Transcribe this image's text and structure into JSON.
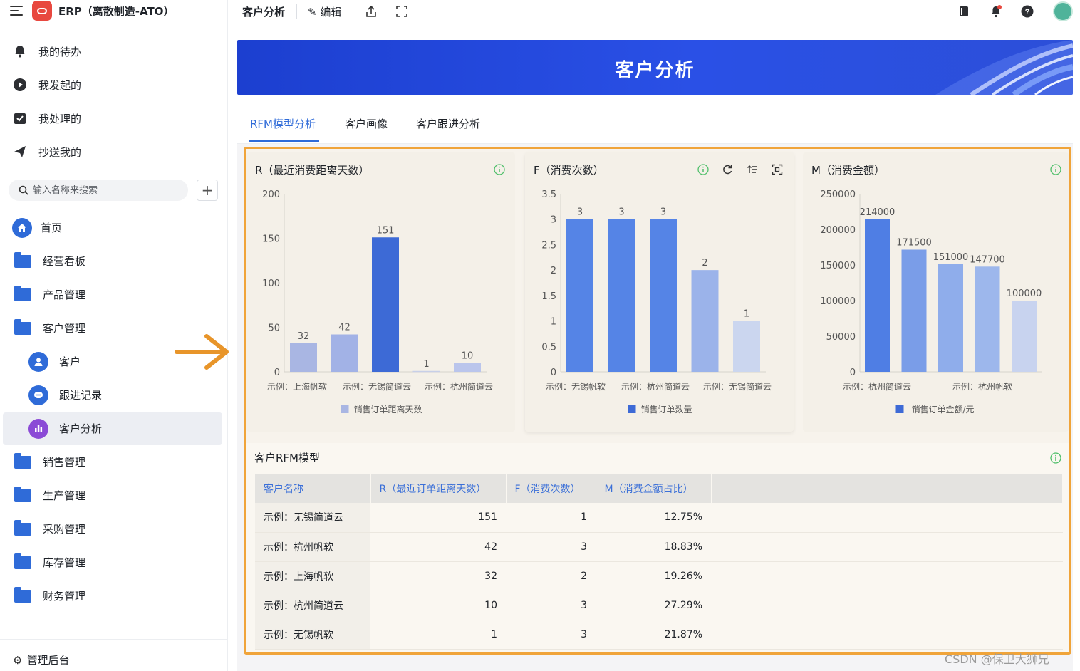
{
  "app": {
    "title": "ERP（离散制造-ATO）"
  },
  "quick_items": [
    {
      "label": "我的待办",
      "icon": "bell-icon"
    },
    {
      "label": "我发起的",
      "icon": "play-circle-icon"
    },
    {
      "label": "我处理的",
      "icon": "check-box-icon"
    },
    {
      "label": "抄送我的",
      "icon": "paper-plane-icon"
    }
  ],
  "search": {
    "placeholder": "输入名称来搜索"
  },
  "nav": [
    {
      "label": "首页",
      "icon": "home-icon"
    },
    {
      "label": "经营看板",
      "icon": "folder-icon"
    },
    {
      "label": "产品管理",
      "icon": "folder-icon"
    },
    {
      "label": "客户管理",
      "icon": "folder-icon"
    },
    {
      "label": "客户",
      "icon": "user-icon"
    },
    {
      "label": "跟进记录",
      "icon": "message-icon"
    },
    {
      "label": "客户分析",
      "icon": "bar-chart-icon"
    },
    {
      "label": "销售管理",
      "icon": "folder-icon"
    },
    {
      "label": "生产管理",
      "icon": "folder-icon"
    },
    {
      "label": "采购管理",
      "icon": "folder-icon"
    },
    {
      "label": "库存管理",
      "icon": "folder-icon"
    },
    {
      "label": "财务管理",
      "icon": "folder-icon"
    }
  ],
  "admin": {
    "label": "管理后台"
  },
  "topbar": {
    "page_name": "客户分析",
    "edit_label": "编辑"
  },
  "banner": {
    "title": "客户分析"
  },
  "tabs": [
    "RFM模型分析",
    "客户画像",
    "客户跟进分析"
  ],
  "colors": {
    "accent": "#2f6bd8",
    "highlight": "#f0a43a",
    "banner": "#2a50e6"
  },
  "chart_data": [
    {
      "type": "bar",
      "title": "R（最近消费距离天数）",
      "categories": [
        "示例：上海帆软",
        "示例：无锡简道云",
        "示例：杭州帆软",
        "示例：无锡帆软",
        "示例：杭州简道云"
      ],
      "x_tick_labels": [
        "示例：上海帆软",
        "示例：无锡简道云",
        "示例：杭州简道云"
      ],
      "values": [
        32,
        42,
        151,
        1,
        10
      ],
      "y_ticks": [
        "200",
        "150",
        "100",
        "50",
        "0"
      ],
      "ylim": [
        0,
        200
      ],
      "legend": "销售订单距离天数",
      "legend_position": "bottom"
    },
    {
      "type": "bar",
      "title": "F（消费次数）",
      "categories": [
        "示例：无锡帆软",
        "示例：杭州帆软",
        "示例：杭州简道云",
        "示例：上海帆软",
        "示例：无锡简道云"
      ],
      "x_tick_labels": [
        "示例：无锡帆软",
        "示例：杭州简道云",
        "示例：无锡简道云"
      ],
      "values": [
        3,
        3,
        3,
        2,
        1
      ],
      "y_ticks": [
        "3.5",
        "3",
        "2.5",
        "2",
        "1.5",
        "1",
        "0.5",
        "0"
      ],
      "ylim": [
        0,
        3.5
      ],
      "legend": "销售订单数量",
      "legend_position": "bottom"
    },
    {
      "type": "bar",
      "title": "M（消费金额）",
      "categories": [
        "示例：杭州简道云",
        "",
        "",
        "示例：杭州帆软",
        ""
      ],
      "x_tick_labels": [
        "示例：杭州简道云",
        "示例：杭州帆软"
      ],
      "values": [
        214000,
        171500,
        151000,
        147700,
        100000
      ],
      "y_ticks": [
        "250000",
        "200000",
        "150000",
        "100000",
        "50000",
        "0"
      ],
      "ylim": [
        0,
        250000
      ],
      "legend": "销售订单金额/元",
      "legend_position": "bottom"
    }
  ],
  "table": {
    "title": "客户RFM模型",
    "columns": [
      "客户名称",
      "R（最近订单距离天数）",
      "F（消费次数）",
      "M（消费金额占比）"
    ],
    "rows": [
      [
        "示例：无锡简道云",
        "151",
        "1",
        "12.75%"
      ],
      [
        "示例：杭州帆软",
        "42",
        "3",
        "18.83%"
      ],
      [
        "示例：上海帆软",
        "32",
        "2",
        "19.26%"
      ],
      [
        "示例：杭州简道云",
        "10",
        "3",
        "27.29%"
      ],
      [
        "示例：无锡帆软",
        "1",
        "3",
        "21.87%"
      ]
    ]
  },
  "watermark": "CSDN @保卫大狮兄"
}
